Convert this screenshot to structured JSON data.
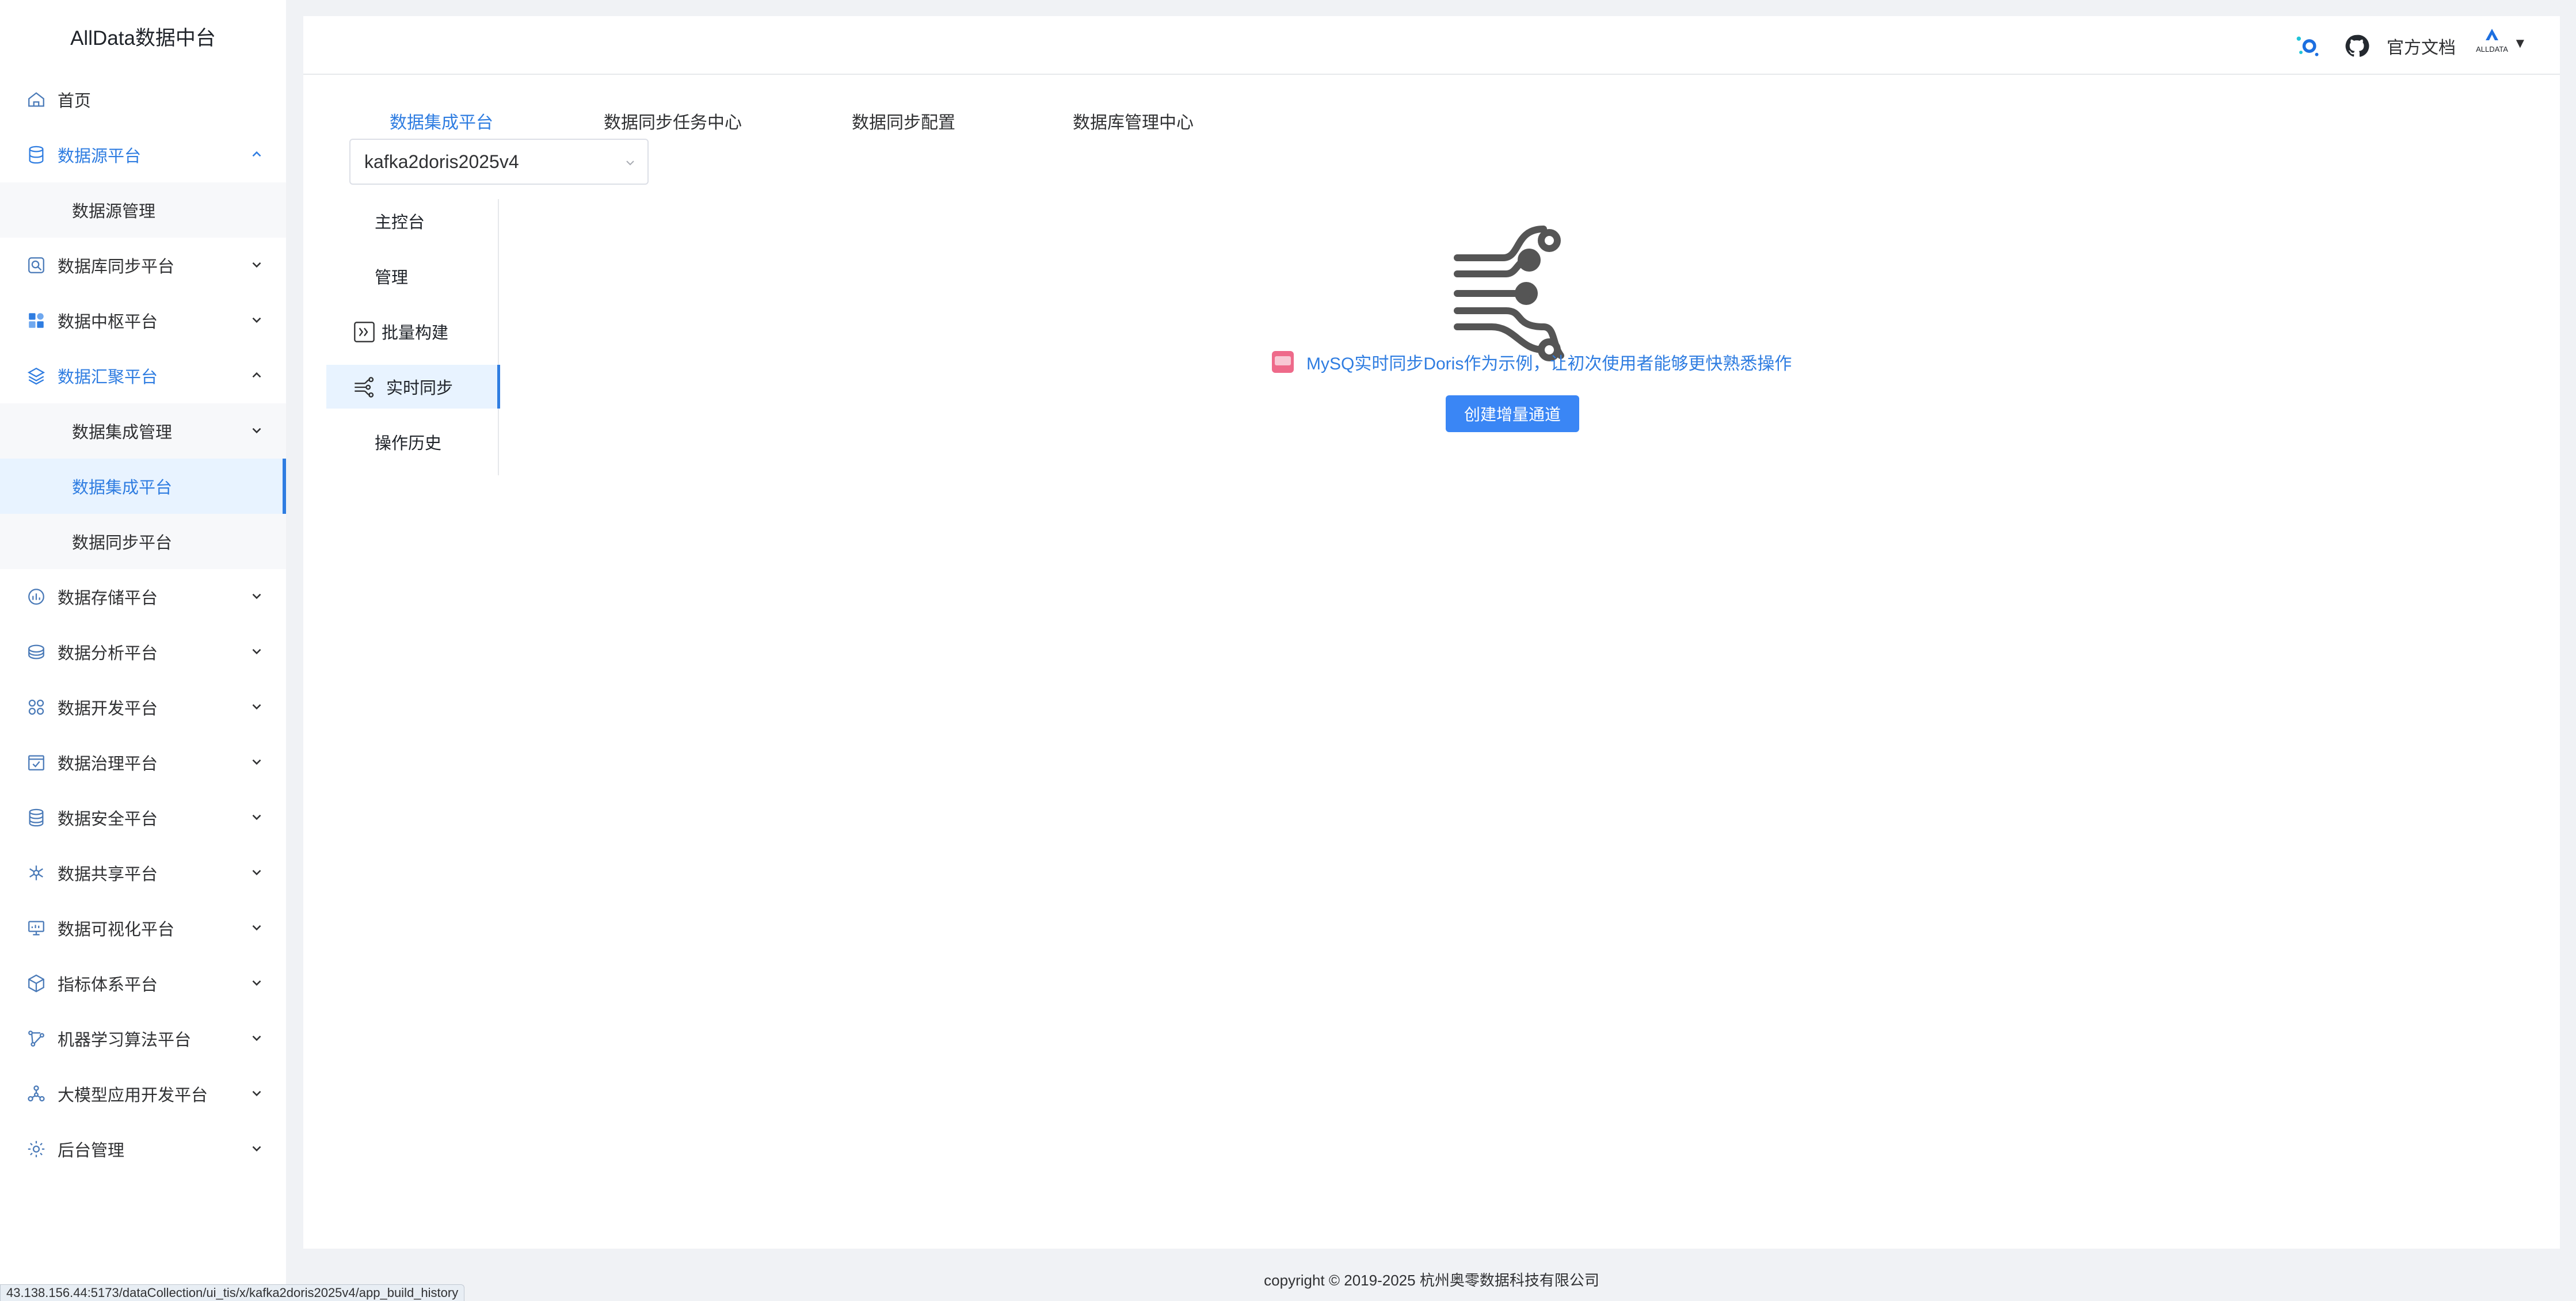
{
  "app": {
    "title": "AllData数据中台"
  },
  "sidebar": {
    "items": [
      {
        "label": "首页",
        "icon": "home-icon"
      },
      {
        "label": "数据源平台",
        "icon": "database-icon",
        "chevron": "up"
      },
      {
        "label": "数据源管理"
      },
      {
        "label": "数据库同步平台",
        "icon": "sync-db-icon",
        "chevron": "down"
      },
      {
        "label": "数据中枢平台",
        "icon": "hub-icon",
        "chevron": "down"
      },
      {
        "label": "数据汇聚平台",
        "icon": "layers-icon",
        "chevron": "up"
      },
      {
        "label": "数据集成管理",
        "chevron": "down"
      },
      {
        "label": "数据集成平台"
      },
      {
        "label": "数据同步平台"
      },
      {
        "label": "数据存储平台",
        "icon": "storage-icon",
        "chevron": "down"
      },
      {
        "label": "数据分析平台",
        "icon": "analysis-icon",
        "chevron": "down"
      },
      {
        "label": "数据开发平台",
        "icon": "dev-icon",
        "chevron": "down"
      },
      {
        "label": "数据治理平台",
        "icon": "governance-icon",
        "chevron": "down"
      },
      {
        "label": "数据安全平台",
        "icon": "security-icon",
        "chevron": "down"
      },
      {
        "label": "数据共享平台",
        "icon": "share-icon",
        "chevron": "down"
      },
      {
        "label": "数据可视化平台",
        "icon": "monitor-icon",
        "chevron": "down"
      },
      {
        "label": "指标体系平台",
        "icon": "cube-icon",
        "chevron": "down"
      },
      {
        "label": "机器学习算法平台",
        "icon": "ml-icon",
        "chevron": "down"
      },
      {
        "label": "大模型应用开发平台",
        "icon": "llm-icon",
        "chevron": "down"
      },
      {
        "label": "后台管理",
        "icon": "settings-icon",
        "chevron": "down"
      }
    ]
  },
  "header": {
    "docs_label": "官方文档",
    "icons": [
      "app-logo-icon",
      "github-icon"
    ],
    "avatar_icon": "alldata-avatar-icon",
    "avatar_label": "ALLDATA"
  },
  "tabs": [
    {
      "label": "数据集成平台",
      "active": true
    },
    {
      "label": "数据同步任务中心"
    },
    {
      "label": "数据同步配置"
    },
    {
      "label": "数据库管理中心"
    }
  ],
  "pipeline_select": {
    "value": "kafka2doris2025v4"
  },
  "subnav": [
    {
      "label": "主控台"
    },
    {
      "label": "管理"
    },
    {
      "label": "批量构建",
      "icon": "batch-build-icon"
    },
    {
      "label": "实时同步",
      "icon": "realtime-sync-icon",
      "active": true
    },
    {
      "label": "操作历史"
    }
  ],
  "empty_state": {
    "icon": "pipeline-flow-icon",
    "hint_icon": "bilibili-icon",
    "hint": "MySQ实时同步Doris作为示例，让初次使用者能够更快熟悉操作",
    "button": "创建增量通道"
  },
  "footer": {
    "copyright": "copyright © 2019-2025 杭州奥零数据科技有限公司"
  },
  "status_url": "43.138.156.44:5173/dataCollection/ui_tis/x/kafka2doris2025v4/app_build_history",
  "colors": {
    "accent": "#2f7de1",
    "button": "#3a86f5",
    "active_bg": "#e8f3ff",
    "page_bg": "#f0f2f5"
  }
}
